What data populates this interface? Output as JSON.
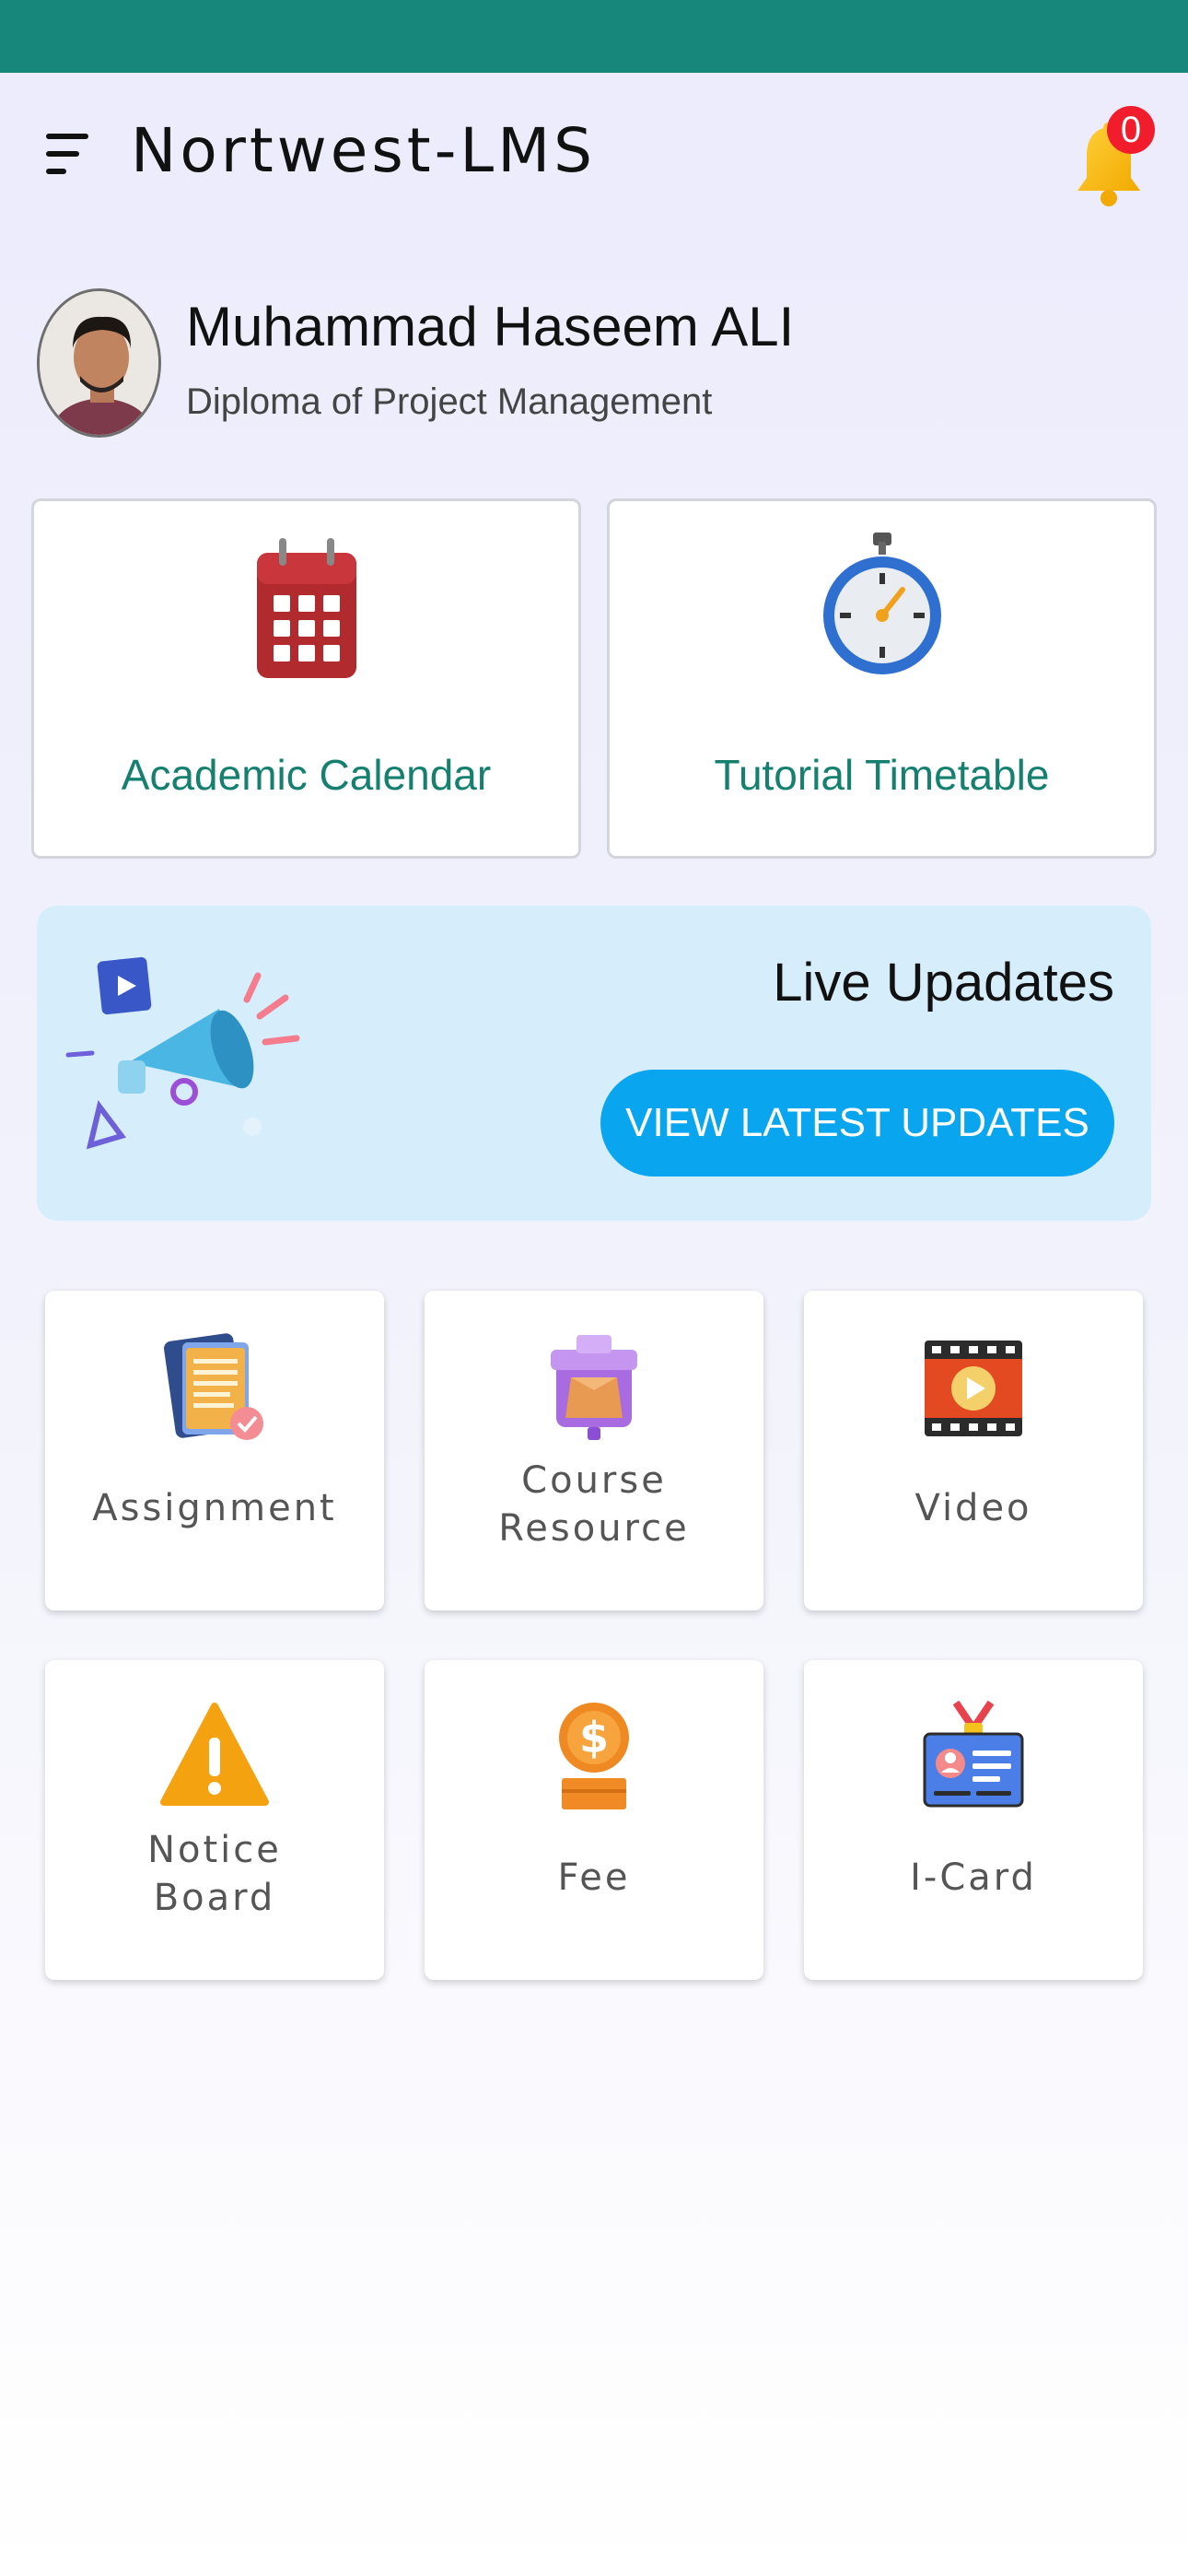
{
  "app": {
    "title": "Nortwest-LMS"
  },
  "header": {
    "notification_count": "0"
  },
  "profile": {
    "name": "Muhammad Haseem ALI",
    "course": "Diploma of Project Management"
  },
  "quick_links": [
    {
      "label": "Academic Calendar",
      "icon": "calendar-icon"
    },
    {
      "label": "Tutorial Timetable",
      "icon": "stopwatch-icon"
    }
  ],
  "updates": {
    "title": "Live Upadates",
    "button_label": "VIEW LATEST UPDATES",
    "icon": "megaphone-icon"
  },
  "tiles": [
    {
      "label": "Assignment",
      "icon": "assignment-icon"
    },
    {
      "label": "Course Resource",
      "line1": "Course",
      "line2": "Resource",
      "icon": "course-resource-box-icon"
    },
    {
      "label": "Video",
      "icon": "video-film-icon"
    },
    {
      "label": "Notice Board",
      "line1": "Notice",
      "line2": "Board",
      "icon": "warning-icon"
    },
    {
      "label": "Fee",
      "icon": "fee-coin-icon"
    },
    {
      "label": "I-Card",
      "icon": "id-card-icon"
    }
  ],
  "colors": {
    "status_bar": "#16877a",
    "accent_green": "#15806f",
    "button_blue": "#0aa5ef",
    "badge_red": "#f21d2c",
    "updates_bg": "#d6eefc"
  }
}
